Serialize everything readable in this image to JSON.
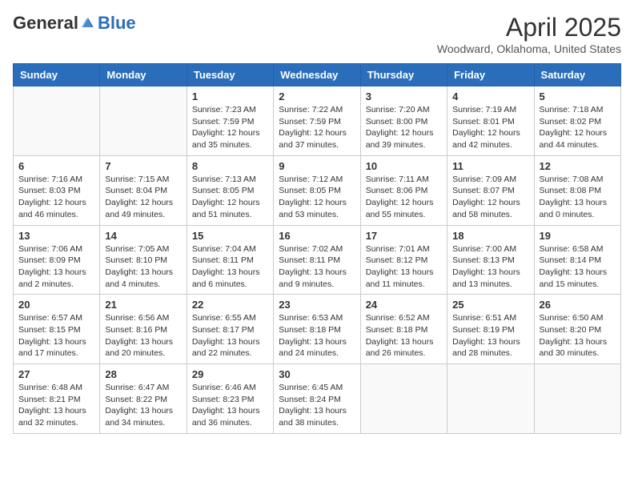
{
  "header": {
    "logo_general": "General",
    "logo_blue": "Blue",
    "month_title": "April 2025",
    "subtitle": "Woodward, Oklahoma, United States"
  },
  "days_of_week": [
    "Sunday",
    "Monday",
    "Tuesday",
    "Wednesday",
    "Thursday",
    "Friday",
    "Saturday"
  ],
  "weeks": [
    [
      {
        "day": "",
        "info": ""
      },
      {
        "day": "",
        "info": ""
      },
      {
        "day": "1",
        "info": "Sunrise: 7:23 AM\nSunset: 7:59 PM\nDaylight: 12 hours and 35 minutes."
      },
      {
        "day": "2",
        "info": "Sunrise: 7:22 AM\nSunset: 7:59 PM\nDaylight: 12 hours and 37 minutes."
      },
      {
        "day": "3",
        "info": "Sunrise: 7:20 AM\nSunset: 8:00 PM\nDaylight: 12 hours and 39 minutes."
      },
      {
        "day": "4",
        "info": "Sunrise: 7:19 AM\nSunset: 8:01 PM\nDaylight: 12 hours and 42 minutes."
      },
      {
        "day": "5",
        "info": "Sunrise: 7:18 AM\nSunset: 8:02 PM\nDaylight: 12 hours and 44 minutes."
      }
    ],
    [
      {
        "day": "6",
        "info": "Sunrise: 7:16 AM\nSunset: 8:03 PM\nDaylight: 12 hours and 46 minutes."
      },
      {
        "day": "7",
        "info": "Sunrise: 7:15 AM\nSunset: 8:04 PM\nDaylight: 12 hours and 49 minutes."
      },
      {
        "day": "8",
        "info": "Sunrise: 7:13 AM\nSunset: 8:05 PM\nDaylight: 12 hours and 51 minutes."
      },
      {
        "day": "9",
        "info": "Sunrise: 7:12 AM\nSunset: 8:05 PM\nDaylight: 12 hours and 53 minutes."
      },
      {
        "day": "10",
        "info": "Sunrise: 7:11 AM\nSunset: 8:06 PM\nDaylight: 12 hours and 55 minutes."
      },
      {
        "day": "11",
        "info": "Sunrise: 7:09 AM\nSunset: 8:07 PM\nDaylight: 12 hours and 58 minutes."
      },
      {
        "day": "12",
        "info": "Sunrise: 7:08 AM\nSunset: 8:08 PM\nDaylight: 13 hours and 0 minutes."
      }
    ],
    [
      {
        "day": "13",
        "info": "Sunrise: 7:06 AM\nSunset: 8:09 PM\nDaylight: 13 hours and 2 minutes."
      },
      {
        "day": "14",
        "info": "Sunrise: 7:05 AM\nSunset: 8:10 PM\nDaylight: 13 hours and 4 minutes."
      },
      {
        "day": "15",
        "info": "Sunrise: 7:04 AM\nSunset: 8:11 PM\nDaylight: 13 hours and 6 minutes."
      },
      {
        "day": "16",
        "info": "Sunrise: 7:02 AM\nSunset: 8:11 PM\nDaylight: 13 hours and 9 minutes."
      },
      {
        "day": "17",
        "info": "Sunrise: 7:01 AM\nSunset: 8:12 PM\nDaylight: 13 hours and 11 minutes."
      },
      {
        "day": "18",
        "info": "Sunrise: 7:00 AM\nSunset: 8:13 PM\nDaylight: 13 hours and 13 minutes."
      },
      {
        "day": "19",
        "info": "Sunrise: 6:58 AM\nSunset: 8:14 PM\nDaylight: 13 hours and 15 minutes."
      }
    ],
    [
      {
        "day": "20",
        "info": "Sunrise: 6:57 AM\nSunset: 8:15 PM\nDaylight: 13 hours and 17 minutes."
      },
      {
        "day": "21",
        "info": "Sunrise: 6:56 AM\nSunset: 8:16 PM\nDaylight: 13 hours and 20 minutes."
      },
      {
        "day": "22",
        "info": "Sunrise: 6:55 AM\nSunset: 8:17 PM\nDaylight: 13 hours and 22 minutes."
      },
      {
        "day": "23",
        "info": "Sunrise: 6:53 AM\nSunset: 8:18 PM\nDaylight: 13 hours and 24 minutes."
      },
      {
        "day": "24",
        "info": "Sunrise: 6:52 AM\nSunset: 8:18 PM\nDaylight: 13 hours and 26 minutes."
      },
      {
        "day": "25",
        "info": "Sunrise: 6:51 AM\nSunset: 8:19 PM\nDaylight: 13 hours and 28 minutes."
      },
      {
        "day": "26",
        "info": "Sunrise: 6:50 AM\nSunset: 8:20 PM\nDaylight: 13 hours and 30 minutes."
      }
    ],
    [
      {
        "day": "27",
        "info": "Sunrise: 6:48 AM\nSunset: 8:21 PM\nDaylight: 13 hours and 32 minutes."
      },
      {
        "day": "28",
        "info": "Sunrise: 6:47 AM\nSunset: 8:22 PM\nDaylight: 13 hours and 34 minutes."
      },
      {
        "day": "29",
        "info": "Sunrise: 6:46 AM\nSunset: 8:23 PM\nDaylight: 13 hours and 36 minutes."
      },
      {
        "day": "30",
        "info": "Sunrise: 6:45 AM\nSunset: 8:24 PM\nDaylight: 13 hours and 38 minutes."
      },
      {
        "day": "",
        "info": ""
      },
      {
        "day": "",
        "info": ""
      },
      {
        "day": "",
        "info": ""
      }
    ]
  ]
}
